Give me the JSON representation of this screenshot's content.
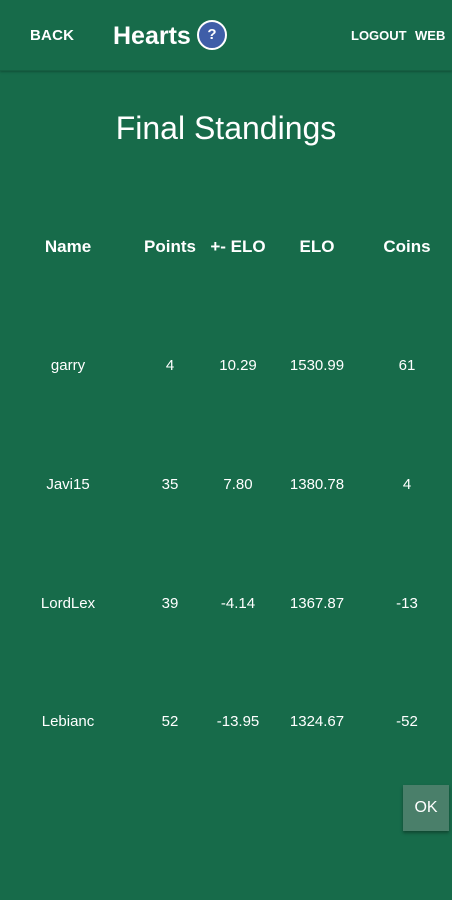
{
  "header": {
    "back_label": "BACK",
    "app_title": "Hearts",
    "help_icon": "?",
    "logout_label": "LOGOUT",
    "web_label": "WEB"
  },
  "page_title": "Final Standings",
  "table": {
    "columns": [
      "Name",
      "Points",
      "+- ELO",
      "ELO",
      "Coins"
    ],
    "rows": [
      [
        "garry",
        "4",
        "10.29",
        "1530.99",
        "61"
      ],
      [
        "Javi15",
        "35",
        "7.80",
        "1380.78",
        "4"
      ],
      [
        "LordLex",
        "39",
        "-4.14",
        "1367.87",
        "-13"
      ],
      [
        "Lebianc",
        "52",
        "-13.95",
        "1324.67",
        "-52"
      ]
    ]
  },
  "ok_label": "OK",
  "colors": {
    "background": "#176b4a",
    "help_badge": "#3f5ea8",
    "ok_button": "#4a7f6a"
  }
}
